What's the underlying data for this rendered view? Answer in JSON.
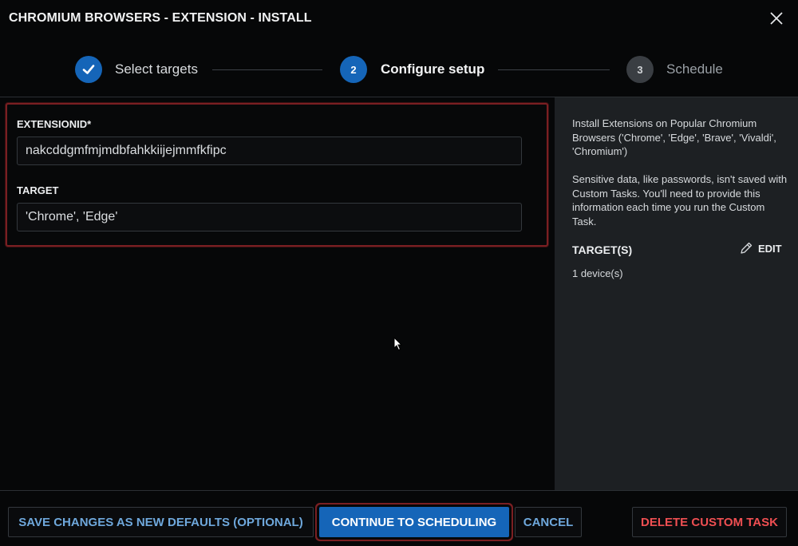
{
  "dialog": {
    "title": "CHROMIUM BROWSERS - EXTENSION - INSTALL"
  },
  "stepper": {
    "steps": [
      {
        "number": "",
        "label": "Select targets",
        "state": "complete"
      },
      {
        "number": "2",
        "label": "Configure setup",
        "state": "active"
      },
      {
        "number": "3",
        "label": "Schedule",
        "state": "upcoming"
      }
    ]
  },
  "form": {
    "extension_id": {
      "label": "EXTENSIONID*",
      "value": "nakcddgmfmjmdbfahkkiijejmmfkfipc"
    },
    "target": {
      "label": "TARGET",
      "value": "'Chrome', 'Edge'"
    }
  },
  "sidebar": {
    "description": "Install Extensions on Popular Chromium Browsers ('Chrome', 'Edge', 'Brave', 'Vivaldi', 'Chromium')",
    "notice": "Sensitive data, like passwords, isn't saved with Custom Tasks. You'll need to provide this information each time you run the Custom Task.",
    "targets_heading": "TARGET(S)",
    "edit_label": "EDIT",
    "targets_count": "1 device(s)"
  },
  "footer": {
    "save_defaults_label": "SAVE CHANGES AS NEW DEFAULTS (OPTIONAL)",
    "continue_label": "CONTINUE TO SCHEDULING",
    "cancel_label": "CANCEL",
    "delete_label": "DELETE CUSTOM TASK"
  },
  "colors": {
    "primary": "#1565b8",
    "danger": "#ef4f52",
    "link": "#6fa8dc",
    "highlight_border": "#7a1f22"
  },
  "icons": {
    "close": "close-icon",
    "check": "check-icon",
    "edit": "pencil-icon"
  }
}
